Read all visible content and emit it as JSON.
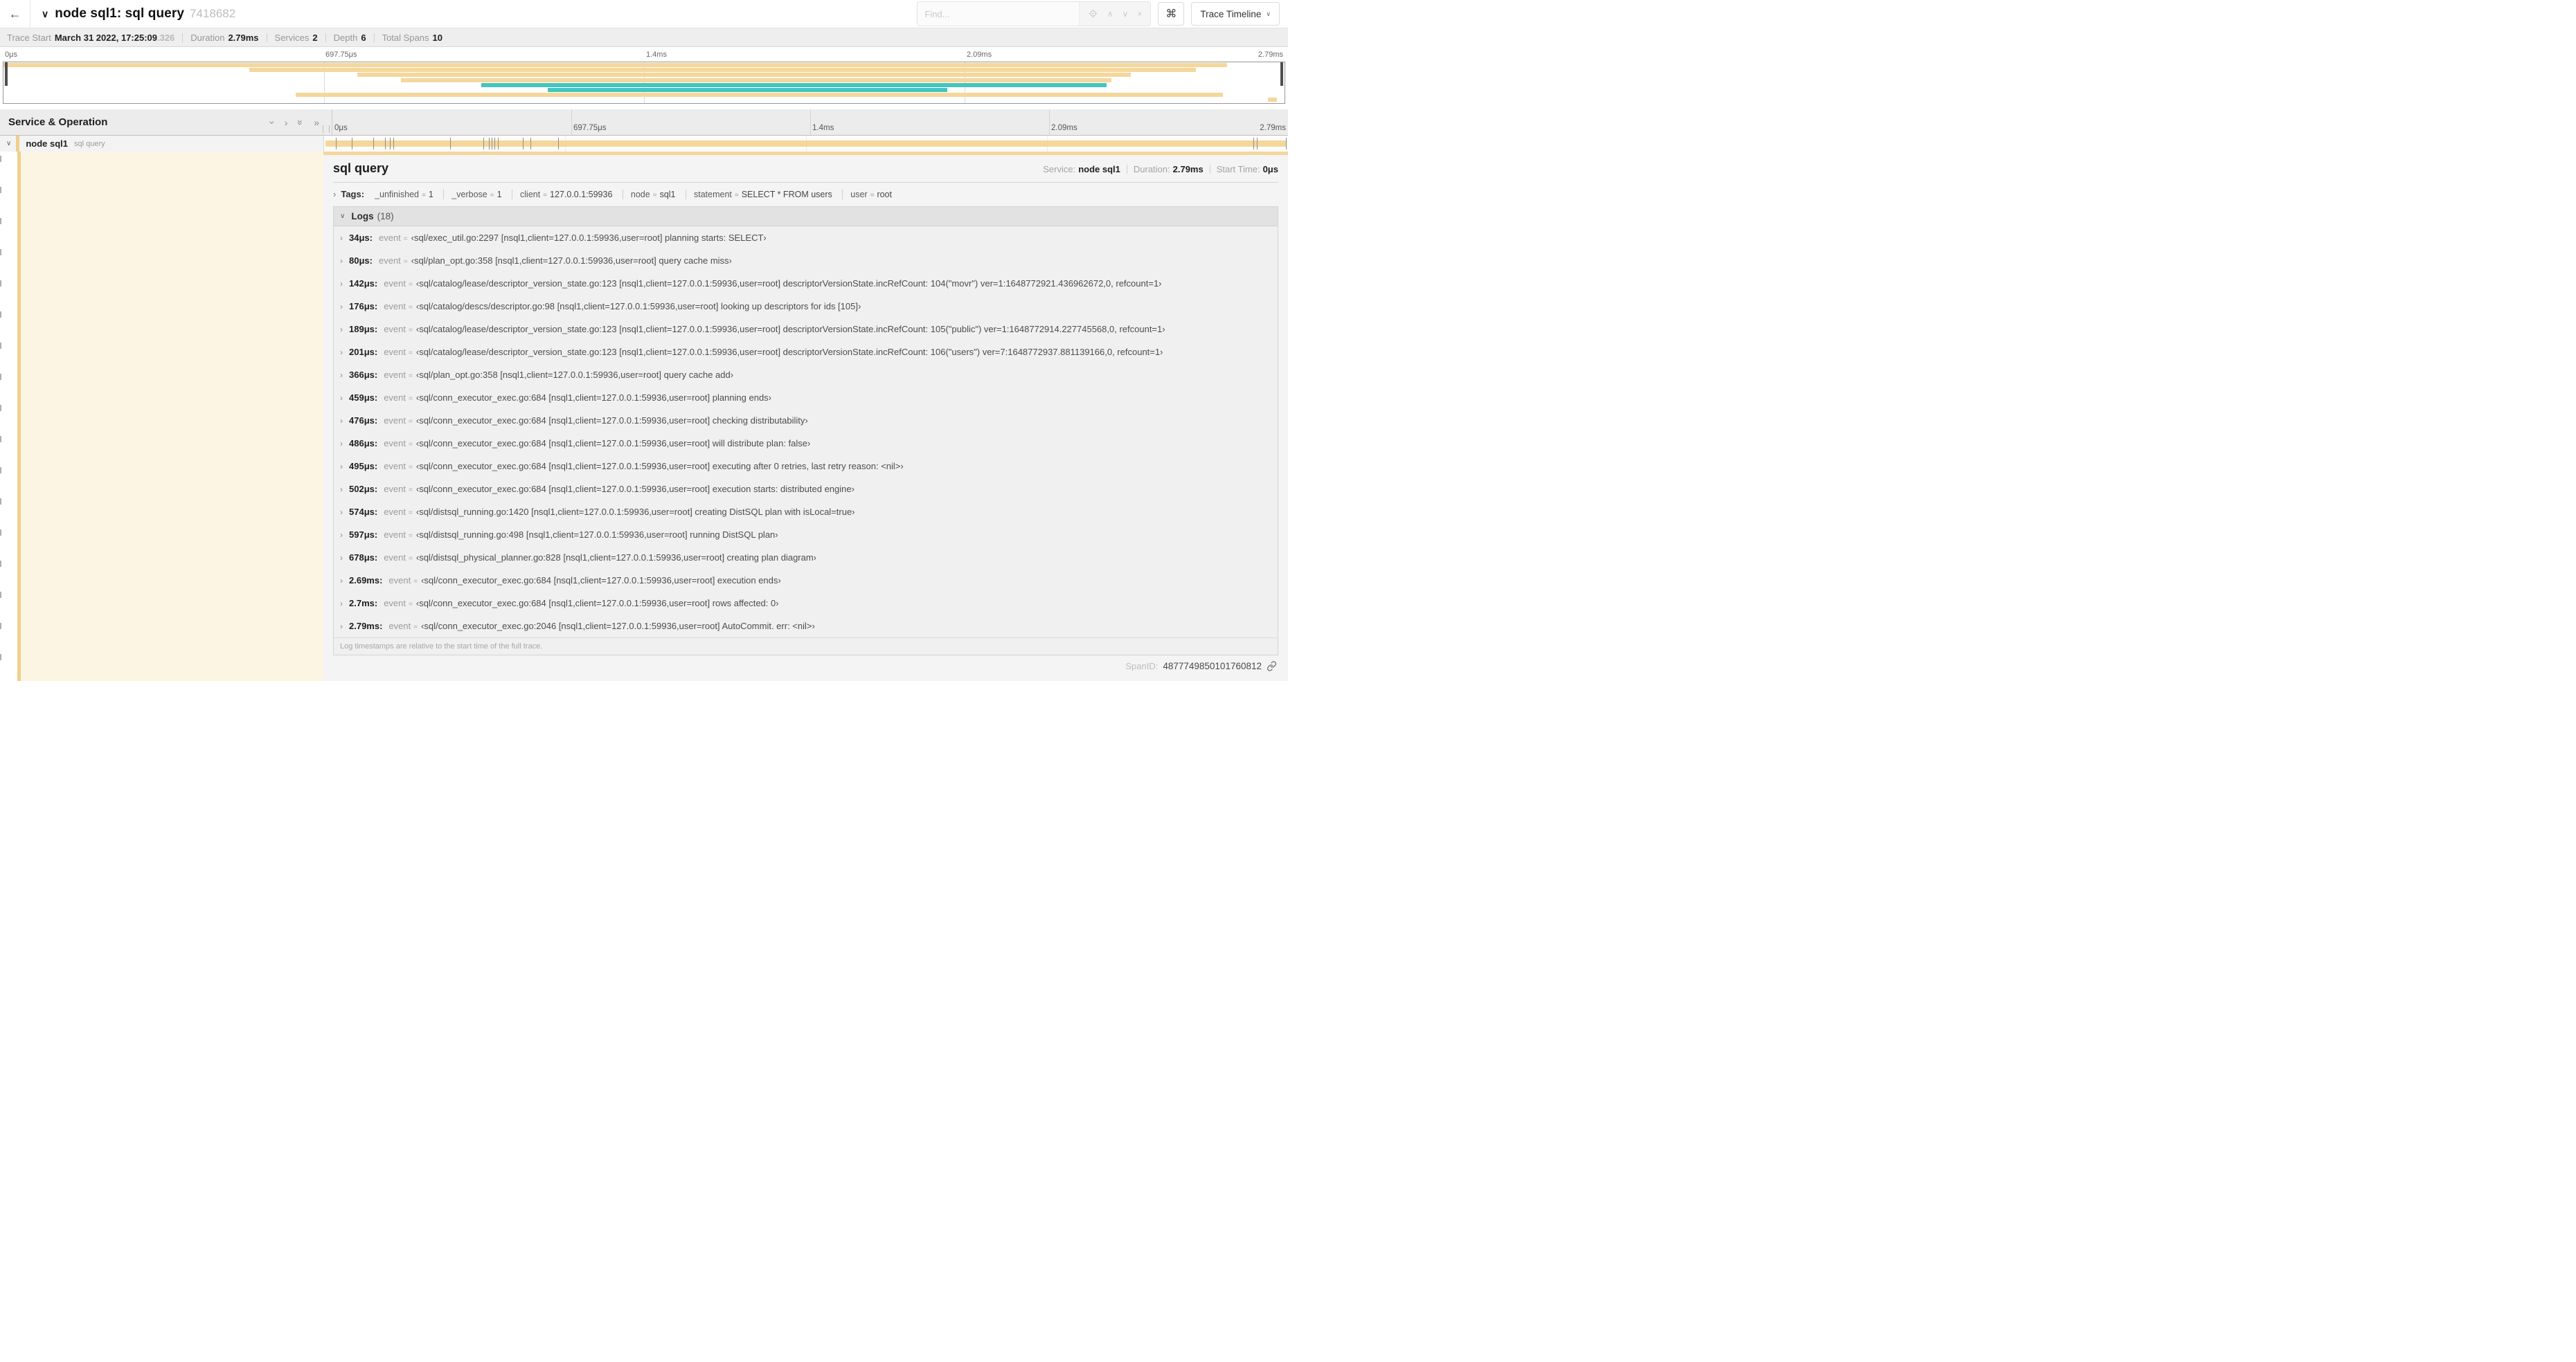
{
  "symbols": {
    "back": "←",
    "chevron_down_bold": "∨",
    "chevron_down": "∨",
    "chevron_right": "›",
    "chevron_double": "»",
    "chevron_up": "∧",
    "close": "×",
    "command": "⌘",
    "eq": "="
  },
  "colors": {
    "tan": "#f5d79b",
    "tan_stripe": "#f0cf8e",
    "teal": "#44c5c0",
    "cream": "#fcf5e3"
  },
  "header": {
    "title": "node sql1: sql query",
    "trace_id_short": "7418682",
    "find_placeholder": "Find...",
    "keyboard_shortcut_label": "⌘",
    "view_selector_label": "Trace Timeline"
  },
  "trace_stats": {
    "trace_start_label": "Trace Start",
    "trace_start_value": "March 31 2022, 17:25:09",
    "trace_start_fraction": ".326",
    "duration_label": "Duration",
    "duration_value": "2.79ms",
    "services_label": "Services",
    "services_value": "2",
    "depth_label": "Depth",
    "depth_value": "6",
    "total_spans_label": "Total Spans",
    "total_spans_value": "10"
  },
  "minimap": {
    "ticks": [
      {
        "label": "0μs",
        "pos": 0
      },
      {
        "label": "697.75μs",
        "pos": 25
      },
      {
        "label": "1.4ms",
        "pos": 50
      },
      {
        "label": "2.09ms",
        "pos": 75
      },
      {
        "label": "2.79ms",
        "pos": 100,
        "align": "right"
      }
    ],
    "spans": [
      {
        "row": 0,
        "left": 0,
        "width": 95.5,
        "color": "tan"
      },
      {
        "row": 1,
        "left": 19.2,
        "width": 73.9,
        "color": "tan"
      },
      {
        "row": 2,
        "left": 27.6,
        "width": 60.4,
        "color": "tan"
      },
      {
        "row": 3,
        "left": 31.0,
        "width": 55.5,
        "color": "tan"
      },
      {
        "row": 4,
        "left": 37.3,
        "width": 48.8,
        "color": "teal"
      },
      {
        "row": 5,
        "left": 42.5,
        "width": 31.2,
        "color": "teal"
      },
      {
        "row": 6,
        "left": 22.8,
        "width": 72.4,
        "color": "tan"
      },
      {
        "row": 7,
        "left": 98.7,
        "width": 0.7,
        "color": "tan"
      }
    ]
  },
  "timeline": {
    "header_label": "Service & Operation",
    "ruler_ticks": [
      {
        "label": "0μs",
        "pos": 0
      },
      {
        "label": "697.75μs",
        "pos": 25
      },
      {
        "label": "1.4ms",
        "pos": 50
      },
      {
        "label": "2.09ms",
        "pos": 75
      },
      {
        "label": "2.79ms",
        "pos": 100,
        "align": "right"
      }
    ],
    "row": {
      "service": "node sql1",
      "operation": "sql query",
      "bar_ticks": [
        {
          "pos": 1.2
        },
        {
          "pos": 2.9
        },
        {
          "pos": 5.1
        },
        {
          "pos": 6.3
        },
        {
          "pos": 6.8
        },
        {
          "pos": 7.2
        },
        {
          "pos": 13.1
        },
        {
          "pos": 16.5
        },
        {
          "pos": 17.1
        },
        {
          "pos": 17.4
        },
        {
          "pos": 17.7
        },
        {
          "pos": 18.0
        },
        {
          "pos": 20.6
        },
        {
          "pos": 21.4
        },
        {
          "pos": 24.3
        },
        {
          "pos": 96.4
        },
        {
          "pos": 96.8
        },
        {
          "pos": 99.8
        }
      ]
    }
  },
  "detail": {
    "title": "sql query",
    "service_label": "Service:",
    "service_value": "node sql1",
    "duration_label": "Duration:",
    "duration_value": "2.79ms",
    "start_label": "Start Time:",
    "start_value": "0μs",
    "tags_label": "Tags:",
    "tags": [
      {
        "key": "_unfinished",
        "value": "1"
      },
      {
        "key": "_verbose",
        "value": "1"
      },
      {
        "key": "client",
        "value": "127.0.0.1:59936"
      },
      {
        "key": "node",
        "value": "sql1"
      },
      {
        "key": "statement",
        "value": "SELECT * FROM users"
      },
      {
        "key": "user",
        "value": "root"
      }
    ],
    "logs_label": "Logs",
    "logs_count": "(18)",
    "logs": [
      {
        "time": "34μs:",
        "key": "event",
        "value": "‹sql/exec_util.go:2297 [nsql1,client=127.0.0.1:59936,user=root] planning starts: SELECT›"
      },
      {
        "time": "80μs:",
        "key": "event",
        "value": "‹sql/plan_opt.go:358 [nsql1,client=127.0.0.1:59936,user=root] query cache miss›"
      },
      {
        "time": "142μs:",
        "key": "event",
        "value": "‹sql/catalog/lease/descriptor_version_state.go:123 [nsql1,client=127.0.0.1:59936,user=root] descriptorVersionState.incRefCount: 104(\"movr\") ver=1:1648772921.436962672,0, refcount=1›"
      },
      {
        "time": "176μs:",
        "key": "event",
        "value": "‹sql/catalog/descs/descriptor.go:98 [nsql1,client=127.0.0.1:59936,user=root] looking up descriptors for ids [105]›"
      },
      {
        "time": "189μs:",
        "key": "event",
        "value": "‹sql/catalog/lease/descriptor_version_state.go:123 [nsql1,client=127.0.0.1:59936,user=root] descriptorVersionState.incRefCount: 105(\"public\") ver=1:1648772914.227745568,0, refcount=1›"
      },
      {
        "time": "201μs:",
        "key": "event",
        "value": "‹sql/catalog/lease/descriptor_version_state.go:123 [nsql1,client=127.0.0.1:59936,user=root] descriptorVersionState.incRefCount: 106(\"users\") ver=7:1648772937.881139166,0, refcount=1›"
      },
      {
        "time": "366μs:",
        "key": "event",
        "value": "‹sql/plan_opt.go:358 [nsql1,client=127.0.0.1:59936,user=root] query cache add›"
      },
      {
        "time": "459μs:",
        "key": "event",
        "value": "‹sql/conn_executor_exec.go:684 [nsql1,client=127.0.0.1:59936,user=root] planning ends›"
      },
      {
        "time": "476μs:",
        "key": "event",
        "value": "‹sql/conn_executor_exec.go:684 [nsql1,client=127.0.0.1:59936,user=root] checking distributability›"
      },
      {
        "time": "486μs:",
        "key": "event",
        "value": "‹sql/conn_executor_exec.go:684 [nsql1,client=127.0.0.1:59936,user=root] will distribute plan: false›"
      },
      {
        "time": "495μs:",
        "key": "event",
        "value": "‹sql/conn_executor_exec.go:684 [nsql1,client=127.0.0.1:59936,user=root] executing after 0 retries, last retry reason: <nil>›"
      },
      {
        "time": "502μs:",
        "key": "event",
        "value": "‹sql/conn_executor_exec.go:684 [nsql1,client=127.0.0.1:59936,user=root] execution starts: distributed engine›"
      },
      {
        "time": "574μs:",
        "key": "event",
        "value": "‹sql/distsql_running.go:1420 [nsql1,client=127.0.0.1:59936,user=root] creating DistSQL plan with isLocal=true›"
      },
      {
        "time": "597μs:",
        "key": "event",
        "value": "‹sql/distsql_running.go:498 [nsql1,client=127.0.0.1:59936,user=root] running DistSQL plan›"
      },
      {
        "time": "678μs:",
        "key": "event",
        "value": "‹sql/distsql_physical_planner.go:828 [nsql1,client=127.0.0.1:59936,user=root] creating plan diagram›"
      },
      {
        "time": "2.69ms:",
        "key": "event",
        "value": "‹sql/conn_executor_exec.go:684 [nsql1,client=127.0.0.1:59936,user=root] execution ends›"
      },
      {
        "time": "2.7ms:",
        "key": "event",
        "value": "‹sql/conn_executor_exec.go:684 [nsql1,client=127.0.0.1:59936,user=root] rows affected: 0›"
      },
      {
        "time": "2.79ms:",
        "key": "event",
        "value": "‹sql/conn_executor_exec.go:2046 [nsql1,client=127.0.0.1:59936,user=root] AutoCommit. err: <nil>›"
      }
    ],
    "logs_note": "Log timestamps are relative to the start time of the full trace.",
    "spanid_label": "SpanID:",
    "spanid_value": "4877749850101760812"
  }
}
